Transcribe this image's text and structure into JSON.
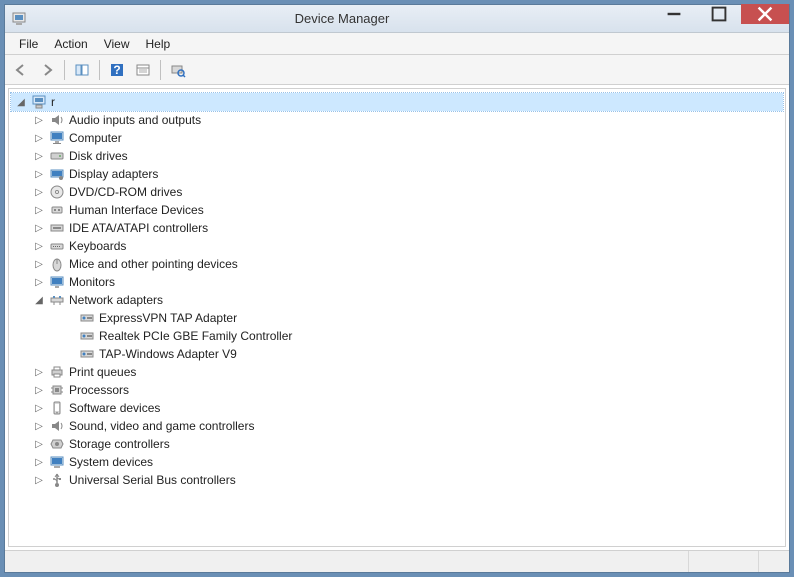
{
  "title": "Device Manager",
  "menu": {
    "file": "File",
    "action": "Action",
    "view": "View",
    "help": "Help"
  },
  "root": {
    "label": "r"
  },
  "nodes": {
    "audio": "Audio inputs and outputs",
    "computer": "Computer",
    "disk": "Disk drives",
    "display": "Display adapters",
    "dvd": "DVD/CD-ROM drives",
    "hid": "Human Interface Devices",
    "ide": "IDE ATA/ATAPI controllers",
    "keyboards": "Keyboards",
    "mice": "Mice and other pointing devices",
    "monitors": "Monitors",
    "network": "Network adapters",
    "net1": "ExpressVPN TAP Adapter",
    "net2": "Realtek PCIe GBE Family Controller",
    "net3": "TAP-Windows Adapter V9",
    "print": "Print queues",
    "proc": "Processors",
    "soft": "Software devices",
    "sound": "Sound, video and game controllers",
    "storage": "Storage controllers",
    "system": "System devices",
    "usb": "Universal Serial Bus controllers"
  }
}
